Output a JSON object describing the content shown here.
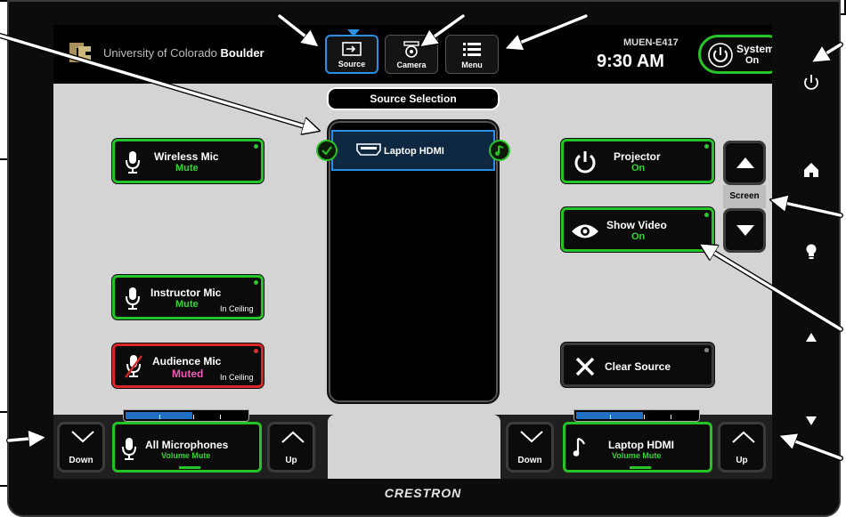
{
  "brand": {
    "university_prefix": "University of Colorado ",
    "university_bold": "Boulder",
    "manufacturer": "CRESTRON"
  },
  "nav": {
    "tabs": [
      {
        "label": "Source",
        "icon": "source-input-icon",
        "active": true
      },
      {
        "label": "Camera",
        "icon": "camera-icon",
        "active": false
      },
      {
        "label": "Menu",
        "icon": "menu-list-icon",
        "active": false
      }
    ]
  },
  "status": {
    "room": "MUEN-E417",
    "time": "9:30 AM"
  },
  "system": {
    "label": "System",
    "state": "On"
  },
  "source_selection": {
    "title": "Source Selection",
    "items": [
      {
        "label": "Laptop HDMI",
        "icon": "hdmi-icon",
        "selected": true,
        "audio": true
      }
    ]
  },
  "mics": [
    {
      "name": "Wireless Mic",
      "state": "Mute",
      "location": "",
      "muted": false
    },
    {
      "name": "Instructor Mic",
      "state": "Mute",
      "location": "In Ceiling",
      "muted": false
    },
    {
      "name": "Audience Mic",
      "state": "Muted",
      "location": "In Ceiling",
      "muted": true
    }
  ],
  "projector": {
    "label": "Projector",
    "state": "On"
  },
  "show_video": {
    "label": "Show Video",
    "state": "On"
  },
  "screen_control": {
    "label": "Screen"
  },
  "clear_source": {
    "label": "Clear Source"
  },
  "volume_left": {
    "down": "Down",
    "up": "Up",
    "label": "All Microphones",
    "sub": "Volume Mute",
    "level": 0.55
  },
  "volume_right": {
    "down": "Down",
    "up": "Up",
    "label": "Laptop HDMI",
    "sub": "Volume Mute",
    "level": 0.55
  },
  "colors": {
    "active_green": "#27c527",
    "muted_red": "#d92626",
    "selected_blue": "#2b8fe3",
    "muted_pink": "#f05bb5"
  }
}
